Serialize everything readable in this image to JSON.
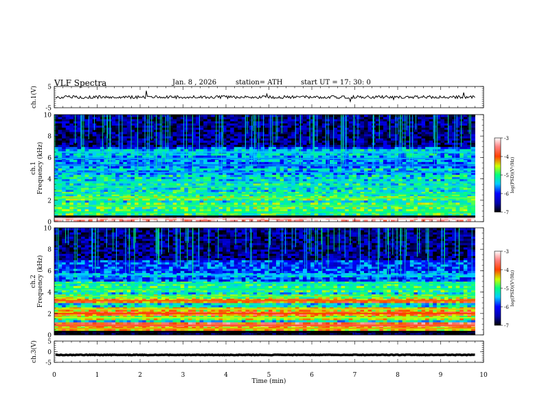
{
  "header": {
    "title": "VLF  Spectra",
    "date": "Jan.  8  ,  2026",
    "station": "station= ATH",
    "start": "start  UT  =    17: 30: 0"
  },
  "chart_data": [
    {
      "type": "line",
      "panel": "ch1_voltage",
      "ylabel": "ch.1(V)",
      "ylim": [
        -5,
        5
      ],
      "yticks": [
        "5",
        "-5"
      ],
      "xlim": [
        0,
        10
      ],
      "baseline": 0,
      "color": "#000000"
    },
    {
      "type": "heatmap",
      "panel": "ch1_spectrogram",
      "ylabel": "ch.1\nFrequency  (kHz)",
      "ylim": [
        0,
        10
      ],
      "yticks": [
        "0",
        "2",
        "4",
        "6",
        "8",
        "10"
      ],
      "xlim": [
        0,
        9.8
      ],
      "colorbar": {
        "label": "log(PSD)(V²/Hz)",
        "range": [
          -7,
          -3
        ],
        "ticks": [
          "-3",
          "-4",
          "-5",
          "-6",
          "-7"
        ]
      },
      "bands": [
        {
          "f": 0.3,
          "level": -3.2
        },
        {
          "f": 0.5,
          "level": -7.0
        },
        {
          "f": 0.9,
          "level": -5.0
        },
        {
          "f": 1.5,
          "level": -4.9
        },
        {
          "f": 2.2,
          "level": -4.8
        },
        {
          "f": 2.6,
          "level": -5.1
        },
        {
          "f": 3.3,
          "level": -5.2
        },
        {
          "f": 3.7,
          "level": -5.3
        },
        {
          "f": 4.6,
          "level": -5.6
        },
        {
          "f": 5.3,
          "level": -5.7
        },
        {
          "f": 5.9,
          "level": -5.6
        },
        {
          "f": 6.5,
          "level": -5.4
        }
      ]
    },
    {
      "type": "heatmap",
      "panel": "ch2_spectrogram",
      "ylabel": "ch.2\nFrequency  (kHz)",
      "ylim": [
        0,
        10
      ],
      "yticks": [
        "0",
        "2",
        "4",
        "6",
        "8",
        "10"
      ],
      "xlim": [
        0,
        9.8
      ],
      "colorbar": {
        "label": "log(PSD)(V²/Hz)",
        "range": [
          -7,
          -3
        ],
        "ticks": [
          "-3",
          "-4",
          "-5",
          "-6",
          "-7"
        ]
      },
      "bands": [
        {
          "f": 0.3,
          "level": -7.0
        },
        {
          "f": 0.6,
          "level": -4.3
        },
        {
          "f": 0.9,
          "level": -3.8
        },
        {
          "f": 1.6,
          "level": -4.6
        },
        {
          "f": 2.0,
          "level": -4.0
        },
        {
          "f": 2.4,
          "level": -4.4
        },
        {
          "f": 3.2,
          "level": -4.1
        },
        {
          "f": 3.6,
          "level": -4.8
        },
        {
          "f": 4.3,
          "level": -5.0
        },
        {
          "f": 4.8,
          "level": -5.1
        },
        {
          "f": 5.6,
          "level": -5.5
        }
      ]
    },
    {
      "type": "line",
      "panel": "ch3_voltage",
      "ylabel": "ch.3(V)",
      "ylim": [
        -5,
        5
      ],
      "yticks": [
        "5",
        "0",
        "-5"
      ],
      "xlim": [
        0,
        10
      ],
      "baseline": -1.5,
      "color": "#000000"
    }
  ],
  "xaxis": {
    "label": "Time  (min)",
    "ticks": [
      "0",
      "1",
      "2",
      "3",
      "4",
      "5",
      "6",
      "7",
      "8",
      "9",
      "10"
    ]
  }
}
